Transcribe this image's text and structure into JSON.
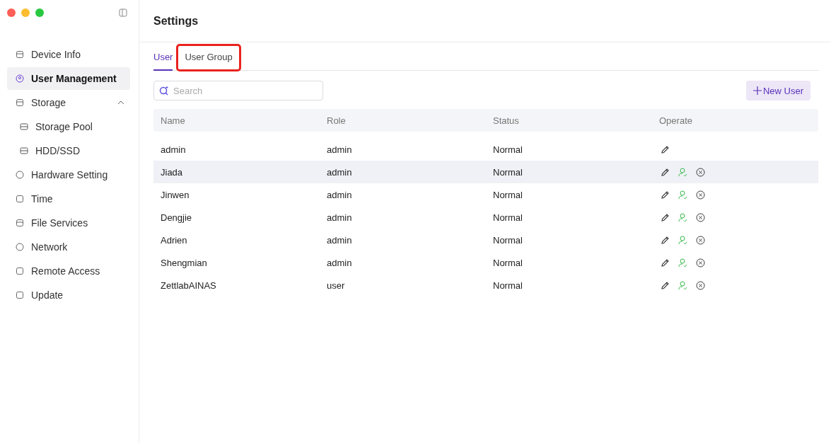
{
  "sidebar": {
    "items": [
      {
        "label": "Device Info",
        "selected": false
      },
      {
        "label": "User Management",
        "selected": true
      },
      {
        "label": "Storage",
        "selected": false,
        "expanded": true,
        "children": [
          {
            "label": "Storage Pool",
            "selected": false
          },
          {
            "label": "HDD/SSD",
            "selected": false
          }
        ]
      },
      {
        "label": "Hardware Setting",
        "selected": false
      },
      {
        "label": "Time",
        "selected": false
      },
      {
        "label": "File Services",
        "selected": false
      },
      {
        "label": "Network",
        "selected": false
      },
      {
        "label": "Remote Access",
        "selected": false
      },
      {
        "label": "Update",
        "selected": false
      }
    ]
  },
  "header": {
    "title": "Settings"
  },
  "tabs": [
    {
      "label": "User",
      "selected": true,
      "highlighted": false
    },
    {
      "label": "User Group",
      "selected": false,
      "highlighted": true
    }
  ],
  "search": {
    "placeholder": "Search"
  },
  "new_button": {
    "label": "New User"
  },
  "table": {
    "columns": [
      "Name",
      "Role",
      "Status",
      "Operate"
    ],
    "rows": [
      {
        "name": "admin",
        "role": "admin",
        "status": "Normal",
        "selected": false,
        "can_enable": false,
        "can_delete": false
      },
      {
        "name": "Jiada",
        "role": "admin",
        "status": "Normal",
        "selected": true,
        "can_enable": true,
        "can_delete": true
      },
      {
        "name": "Jinwen",
        "role": "admin",
        "status": "Normal",
        "selected": false,
        "can_enable": true,
        "can_delete": true
      },
      {
        "name": "Dengjie",
        "role": "admin",
        "status": "Normal",
        "selected": false,
        "can_enable": true,
        "can_delete": true
      },
      {
        "name": "Adrien",
        "role": "admin",
        "status": "Normal",
        "selected": false,
        "can_enable": true,
        "can_delete": true
      },
      {
        "name": "Shengmian",
        "role": "admin",
        "status": "Normal",
        "selected": false,
        "can_enable": true,
        "can_delete": true
      },
      {
        "name": "ZettlabAINAS",
        "role": "user",
        "status": "Normal",
        "selected": false,
        "can_enable": true,
        "can_delete": true
      }
    ]
  }
}
